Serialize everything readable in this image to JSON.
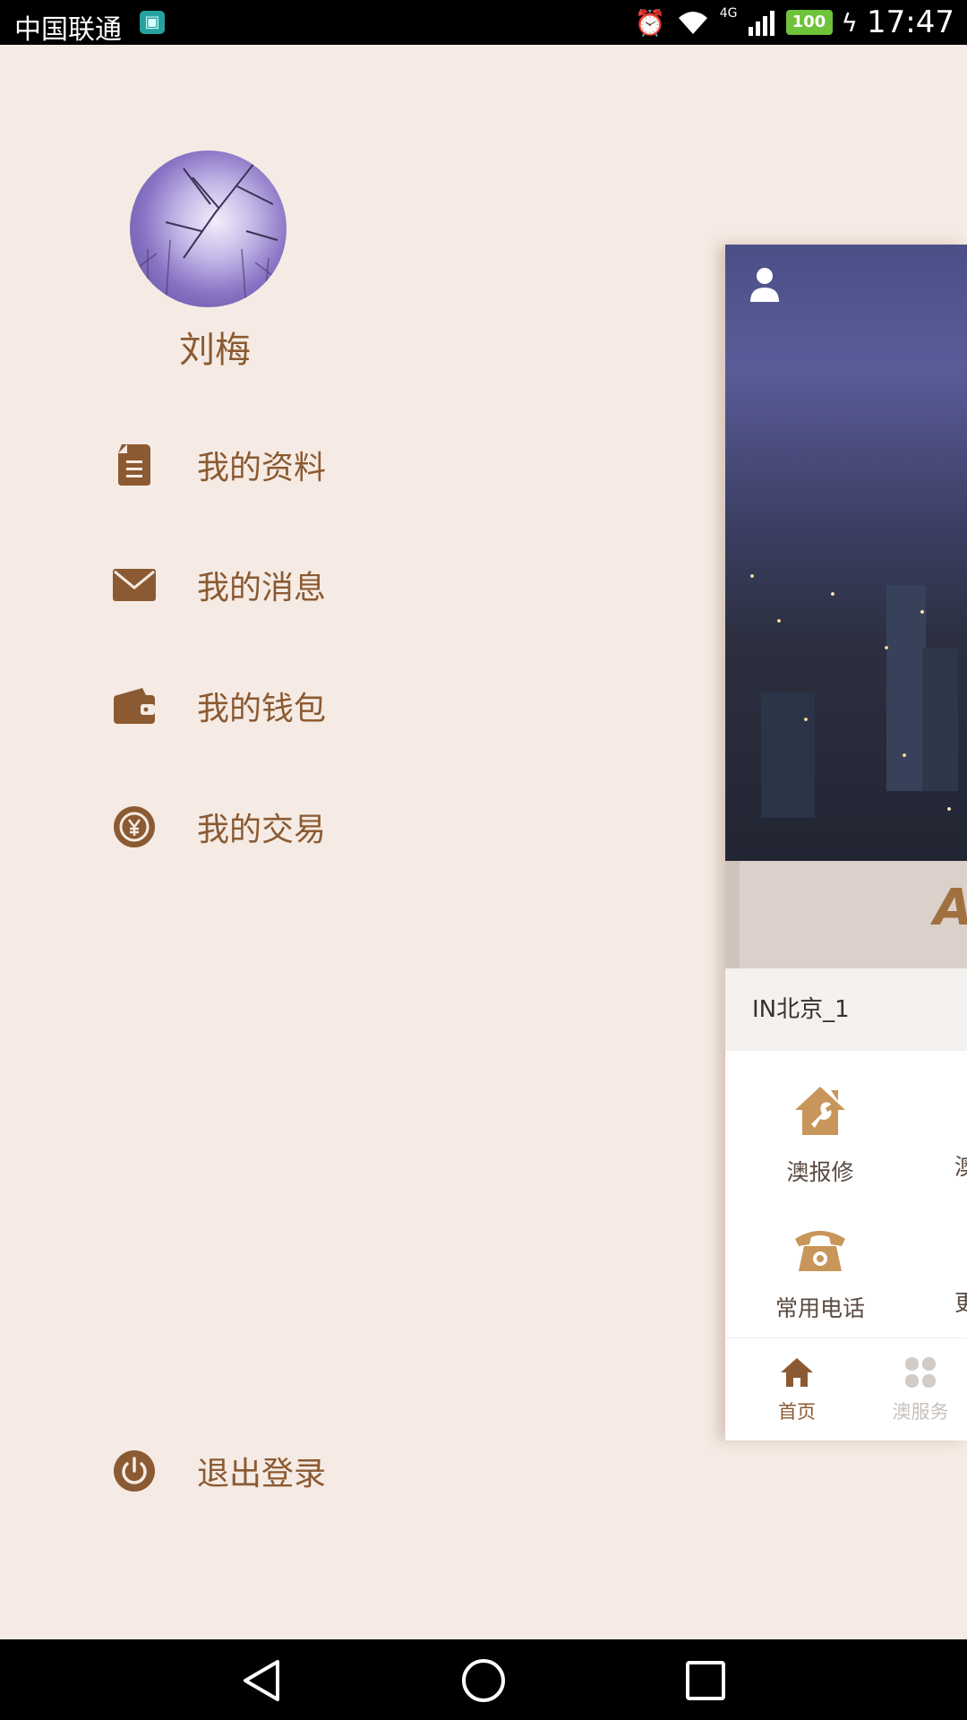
{
  "status_bar": {
    "carrier": "中国联通",
    "network": "4G",
    "battery": "100",
    "time": "17:47",
    "icons": [
      "alarm-icon",
      "wifi-icon",
      "signal-icon",
      "battery-icon",
      "charging-icon"
    ]
  },
  "drawer": {
    "user_name": "刘梅",
    "menu": [
      {
        "icon": "document-icon",
        "label": "我的资料"
      },
      {
        "icon": "mail-icon",
        "label": "我的消息"
      },
      {
        "icon": "wallet-icon",
        "label": "我的钱包"
      },
      {
        "icon": "yuan-coin-icon",
        "label": "我的交易"
      }
    ],
    "logout": {
      "icon": "power-icon",
      "label": "退出登录"
    }
  },
  "main": {
    "location": "IN北京_1",
    "hero_logo_letter": "A",
    "services": [
      {
        "icon": "house-repair-icon",
        "label": "澳报修"
      },
      {
        "icon": "telephone-icon",
        "label": "常用电话"
      }
    ],
    "services_cut": [
      "澳",
      "更"
    ],
    "tabs": [
      {
        "icon": "home-icon",
        "label": "首页",
        "active": true
      },
      {
        "icon": "clover-icon",
        "label": "澳服务",
        "active": false
      }
    ]
  },
  "colors": {
    "accent": "#8b5a32",
    "icon_gold": "#c8965a",
    "drawer_bg": "#f5ebe4"
  }
}
